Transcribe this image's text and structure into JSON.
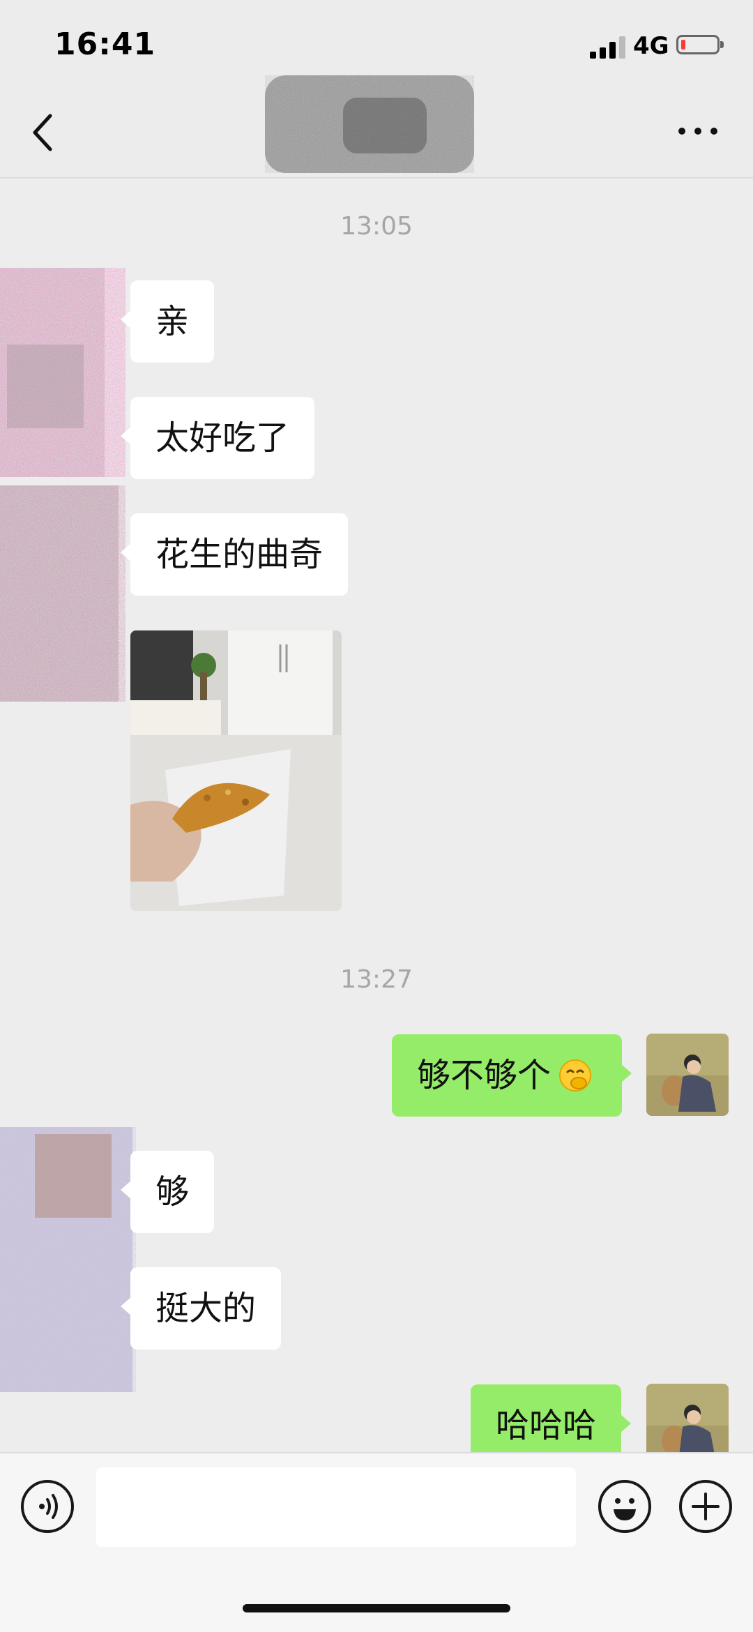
{
  "status_bar": {
    "time": "16:41",
    "network": "4G",
    "battery_level": 0.12,
    "battery_color": "#ff3b30"
  },
  "header": {
    "back_icon": "chevron-left-icon",
    "more_icon": "more-dots-icon"
  },
  "chat": {
    "timestamps": [
      "13:05",
      "13:27"
    ],
    "messages": [
      {
        "side": "in",
        "text": "亲"
      },
      {
        "side": "in",
        "text": "太好吃了"
      },
      {
        "side": "in",
        "text": "花生的曲奇"
      },
      {
        "side": "in",
        "type": "image"
      },
      {
        "side": "out",
        "text": "够不够个",
        "emoji": "face-with-hand-over-mouth"
      },
      {
        "side": "in",
        "text": "够"
      },
      {
        "side": "in",
        "text": "挺大的"
      },
      {
        "side": "out",
        "text": "哈哈哈"
      }
    ]
  },
  "input_bar": {
    "voice_icon": "voice-icon",
    "emoji_icon": "emoji-icon",
    "plus_icon": "plus-icon",
    "text_value": ""
  },
  "colors": {
    "outgoing_bubble": "#95ec69",
    "incoming_bubble": "#ffffff",
    "background": "#ededed"
  }
}
